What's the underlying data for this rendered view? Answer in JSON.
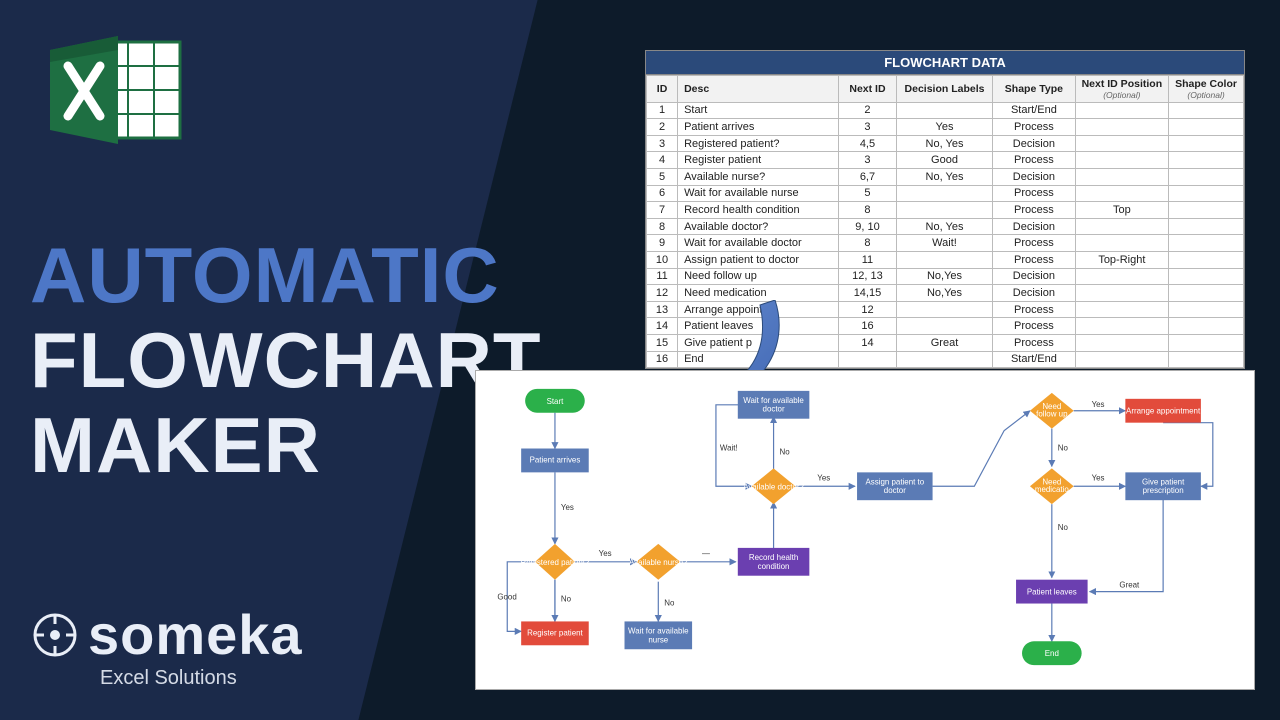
{
  "headline": {
    "line1": "AUTOMATIC",
    "line2": "FLOWCHART",
    "line3": "MAKER"
  },
  "brand": {
    "name": "someka",
    "tagline": "Excel Solutions"
  },
  "table": {
    "title": "FLOWCHART DATA",
    "headers": [
      "ID",
      "Desc",
      "Next ID",
      "Decision Labels",
      "Shape Type",
      "Next ID Position",
      "Shape Color"
    ],
    "optional": "(Optional)",
    "rows": [
      {
        "id": "1",
        "desc": "Start",
        "next": "2",
        "dl": "",
        "type": "Start/End",
        "nip": "",
        "sc": ""
      },
      {
        "id": "2",
        "desc": "Patient arrives",
        "next": "3",
        "dl": "Yes",
        "type": "Process",
        "nip": "",
        "sc": ""
      },
      {
        "id": "3",
        "desc": "Registered patient?",
        "next": "4,5",
        "dl": "No, Yes",
        "type": "Decision",
        "nip": "",
        "sc": ""
      },
      {
        "id": "4",
        "desc": "Register patient",
        "next": "3",
        "dl": "Good",
        "type": "Process",
        "nip": "",
        "sc": ""
      },
      {
        "id": "5",
        "desc": "Available nurse?",
        "next": "6,7",
        "dl": "No, Yes",
        "type": "Decision",
        "nip": "",
        "sc": ""
      },
      {
        "id": "6",
        "desc": "Wait for available nurse",
        "next": "5",
        "dl": "",
        "type": "Process",
        "nip": "",
        "sc": ""
      },
      {
        "id": "7",
        "desc": "Record health condition",
        "next": "8",
        "dl": "",
        "type": "Process",
        "nip": "Top",
        "sc": ""
      },
      {
        "id": "8",
        "desc": "Available doctor?",
        "next": "9, 10",
        "dl": "No, Yes",
        "type": "Decision",
        "nip": "",
        "sc": ""
      },
      {
        "id": "9",
        "desc": "Wait for available doctor",
        "next": "8",
        "dl": "Wait!",
        "type": "Process",
        "nip": "",
        "sc": ""
      },
      {
        "id": "10",
        "desc": "Assign patient to doctor",
        "next": "11",
        "dl": "",
        "type": "Process",
        "nip": "Top-Right",
        "sc": ""
      },
      {
        "id": "11",
        "desc": "Need follow up",
        "next": "12, 13",
        "dl": "No,Yes",
        "type": "Decision",
        "nip": "",
        "sc": ""
      },
      {
        "id": "12",
        "desc": "Need medication",
        "next": "14,15",
        "dl": "No,Yes",
        "type": "Decision",
        "nip": "",
        "sc": ""
      },
      {
        "id": "13",
        "desc": "Arrange appointme",
        "next": "12",
        "dl": "",
        "type": "Process",
        "nip": "",
        "sc": ""
      },
      {
        "id": "14",
        "desc": "Patient leaves",
        "next": "16",
        "dl": "",
        "type": "Process",
        "nip": "",
        "sc": ""
      },
      {
        "id": "15",
        "desc": "Give patient p",
        "next": "14",
        "dl": "Great",
        "type": "Process",
        "nip": "",
        "sc": ""
      },
      {
        "id": "16",
        "desc": "End",
        "next": "",
        "dl": "",
        "type": "Start/End",
        "nip": "",
        "sc": ""
      }
    ]
  },
  "flow": {
    "nodes": {
      "start": "Start",
      "patient_arrives": "Patient arrives",
      "registered": "Registered patient?",
      "register": "Register patient",
      "avail_nurse": "Available nurse?",
      "wait_nurse": "Wait for available nurse",
      "record": "Record health condition",
      "avail_doctor": "Available doctor?",
      "wait_doctor": "Wait for available doctor",
      "assign": "Assign patient to doctor",
      "follow": "Need follow up",
      "medic": "Need medication",
      "arrange": "Arrange appointment",
      "give": "Give patient prescription",
      "leaves": "Patient leaves",
      "end": "End"
    },
    "labels": {
      "yes": "Yes",
      "no": "No",
      "good": "Good",
      "wait": "Wait!",
      "great": "Great"
    }
  }
}
